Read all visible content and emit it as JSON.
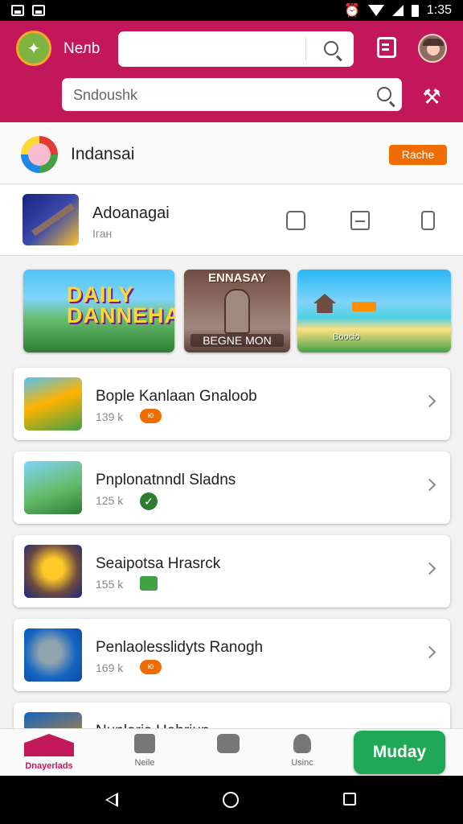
{
  "status_bar": {
    "time": "1:35"
  },
  "header": {
    "app_name": "Nелb",
    "search_top_placeholder": "",
    "search_bottom_placeholder": "Sndoushk"
  },
  "account": {
    "name": "Indansai",
    "badge": "Rache"
  },
  "featured": {
    "title": "Adoanagai",
    "subtitle": "Iган"
  },
  "banners": [
    {
      "title_line1": "DAILY",
      "title_line2": "DANNEHA",
      "subtitle": ""
    },
    {
      "title": "ENNASAY",
      "subtitle": "BEGNE MON"
    },
    {
      "subtitle": "Boocio"
    }
  ],
  "list": [
    {
      "title": "Bople Kanlaan Gnaloob",
      "count": "139 k",
      "badge": "ю"
    },
    {
      "title": "Pnplonatnndl Sladns",
      "count": "125 k",
      "badge": "✓"
    },
    {
      "title": "Seaipotsa Hrasrck",
      "count": "155 k",
      "badge": ""
    },
    {
      "title": "Penlaolesslidyts Ranogh",
      "count": "169 k",
      "badge": "ю"
    },
    {
      "title": "Nunlaris Hahriun",
      "count": "",
      "badge": ""
    }
  ],
  "bottom_nav": {
    "items": [
      {
        "label": "Dnayerlads",
        "icon": "home-icon"
      },
      {
        "label": "Neile",
        "icon": "bag-icon"
      },
      {
        "label": "",
        "icon": "camera-icon"
      },
      {
        "label": "Usinc",
        "icon": "person-icon"
      }
    ],
    "cta_label": "Muday"
  },
  "colors": {
    "primary": "#c2185b",
    "accent_green": "#1fa855",
    "badge_orange": "#ef6c00"
  }
}
